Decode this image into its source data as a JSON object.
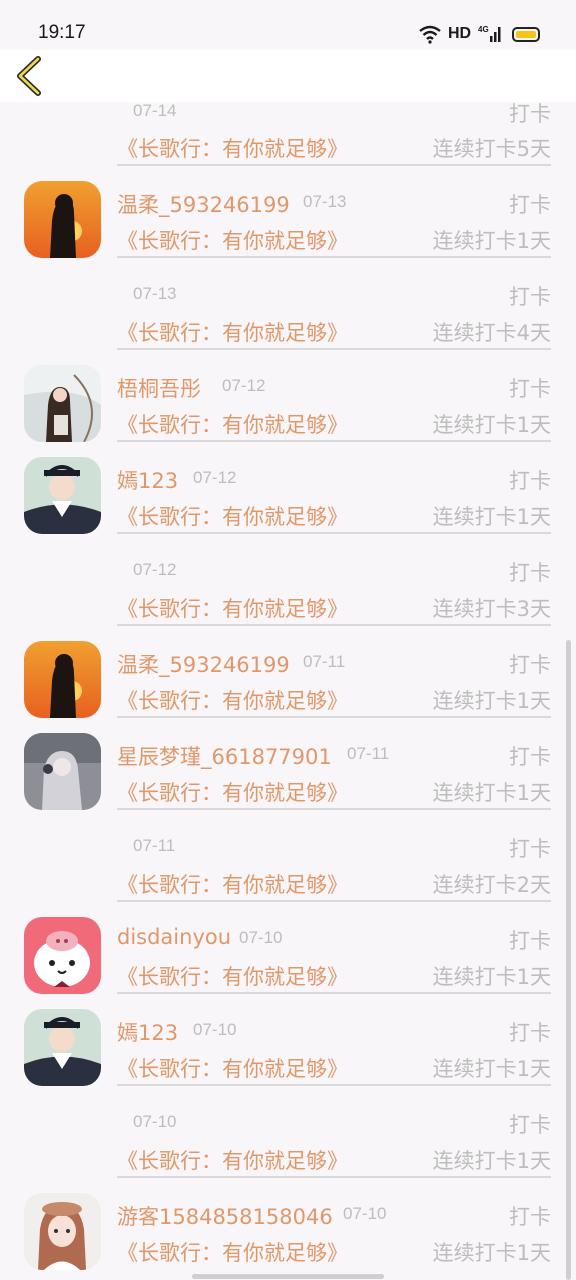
{
  "status": {
    "time": "19:17",
    "network": "HD",
    "signal_label": "4G",
    "icons": [
      "wifi-icon",
      "signal-icon",
      "battery-icon"
    ]
  },
  "header": {
    "back_icon": "chevron-left-icon"
  },
  "colors": {
    "accent": "#e0986a",
    "muted": "#bdbdbd",
    "background": "#f8f6f8",
    "battery": "#f5c518"
  },
  "rows": [
    {
      "user": "",
      "date": "07-14",
      "action": "打卡",
      "book": "《长歌行：有你就足够》",
      "streak": "连续打卡5天",
      "avatar": ""
    },
    {
      "user": "温柔_593246199",
      "date": "07-13",
      "action": "打卡",
      "book": "《长歌行：有你就足够》",
      "streak": "连续打卡1天",
      "avatar": "sunset-silhouette"
    },
    {
      "user": "",
      "date": "07-13",
      "action": "打卡",
      "book": "《长歌行：有你就足够》",
      "streak": "连续打卡4天",
      "avatar": ""
    },
    {
      "user": "梧桐吾彤",
      "date": "07-12",
      "action": "打卡",
      "book": "《长歌行：有你就足够》",
      "streak": "连续打卡1天",
      "avatar": "anime-archer"
    },
    {
      "user": "嫣123",
      "date": "07-12",
      "action": "打卡",
      "book": "《长歌行：有你就足够》",
      "streak": "连续打卡1天",
      "avatar": "uniform-boy"
    },
    {
      "user": "",
      "date": "07-12",
      "action": "打卡",
      "book": "《长歌行：有你就足够》",
      "streak": "连续打卡3天",
      "avatar": ""
    },
    {
      "user": "温柔_593246199",
      "date": "07-11",
      "action": "打卡",
      "book": "《长歌行：有你就足够》",
      "streak": "连续打卡1天",
      "avatar": "sunset-silhouette"
    },
    {
      "user": "星辰梦瑾_661877901",
      "date": "07-11",
      "action": "打卡",
      "book": "《长歌行：有你就足够》",
      "streak": "连续打卡1天",
      "avatar": "grey-girl"
    },
    {
      "user": "",
      "date": "07-11",
      "action": "打卡",
      "book": "《长歌行：有你就足够》",
      "streak": "连续打卡2天",
      "avatar": ""
    },
    {
      "user": "disdainyou",
      "date": "07-10",
      "action": "打卡",
      "book": "《长歌行：有你就足够》",
      "streak": "连续打卡1天",
      "avatar": "pig-sticker"
    },
    {
      "user": "嫣123",
      "date": "07-10",
      "action": "打卡",
      "book": "《长歌行：有你就足够》",
      "streak": "连续打卡1天",
      "avatar": "uniform-boy"
    },
    {
      "user": "",
      "date": "07-10",
      "action": "打卡",
      "book": "《长歌行：有你就足够》",
      "streak": "连续打卡1天",
      "avatar": ""
    },
    {
      "user": "游客1584858158046",
      "date": "07-10",
      "action": "打卡",
      "book": "《长歌行：有你就足够》",
      "streak": "连续打卡1天",
      "avatar": "girl-photo"
    }
  ]
}
